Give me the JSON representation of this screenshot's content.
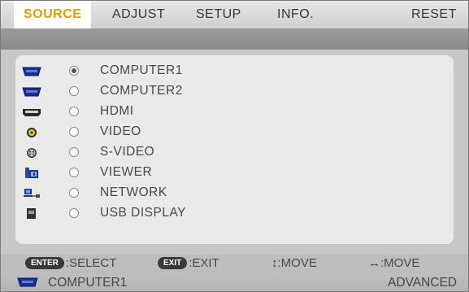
{
  "tabs": [
    {
      "label": "SOURCE",
      "active": true
    },
    {
      "label": "ADJUST"
    },
    {
      "label": "SETUP"
    },
    {
      "label": "INFO."
    },
    {
      "label": "RESET"
    }
  ],
  "sources": [
    {
      "label": "COMPUTER1",
      "icon": "computer-port-icon",
      "selected": true
    },
    {
      "label": "COMPUTER2",
      "icon": "computer-port-icon",
      "selected": false
    },
    {
      "label": "HDMI",
      "icon": "hdmi-port-icon",
      "selected": false
    },
    {
      "label": "VIDEO",
      "icon": "video-jack-icon",
      "selected": false
    },
    {
      "label": "S-VIDEO",
      "icon": "s-video-jack-icon",
      "selected": false
    },
    {
      "label": "VIEWER",
      "icon": "viewer-icon",
      "selected": false
    },
    {
      "label": "NETWORK",
      "icon": "network-icon",
      "selected": false
    },
    {
      "label": "USB DISPLAY",
      "icon": "usb-display-icon",
      "selected": false
    }
  ],
  "help": {
    "enter_key": "ENTER",
    "enter_text": ":SELECT",
    "exit_key": "EXIT",
    "exit_text": ":EXIT",
    "move_vertical": "↕:MOVE",
    "move_horizontal": "↔:MOVE"
  },
  "status": {
    "current_source": "COMPUTER1",
    "menu_mode": "ADVANCED"
  },
  "colors": {
    "active_tab_text": "#e0a000",
    "icon_blue": "#1a2f8f"
  }
}
